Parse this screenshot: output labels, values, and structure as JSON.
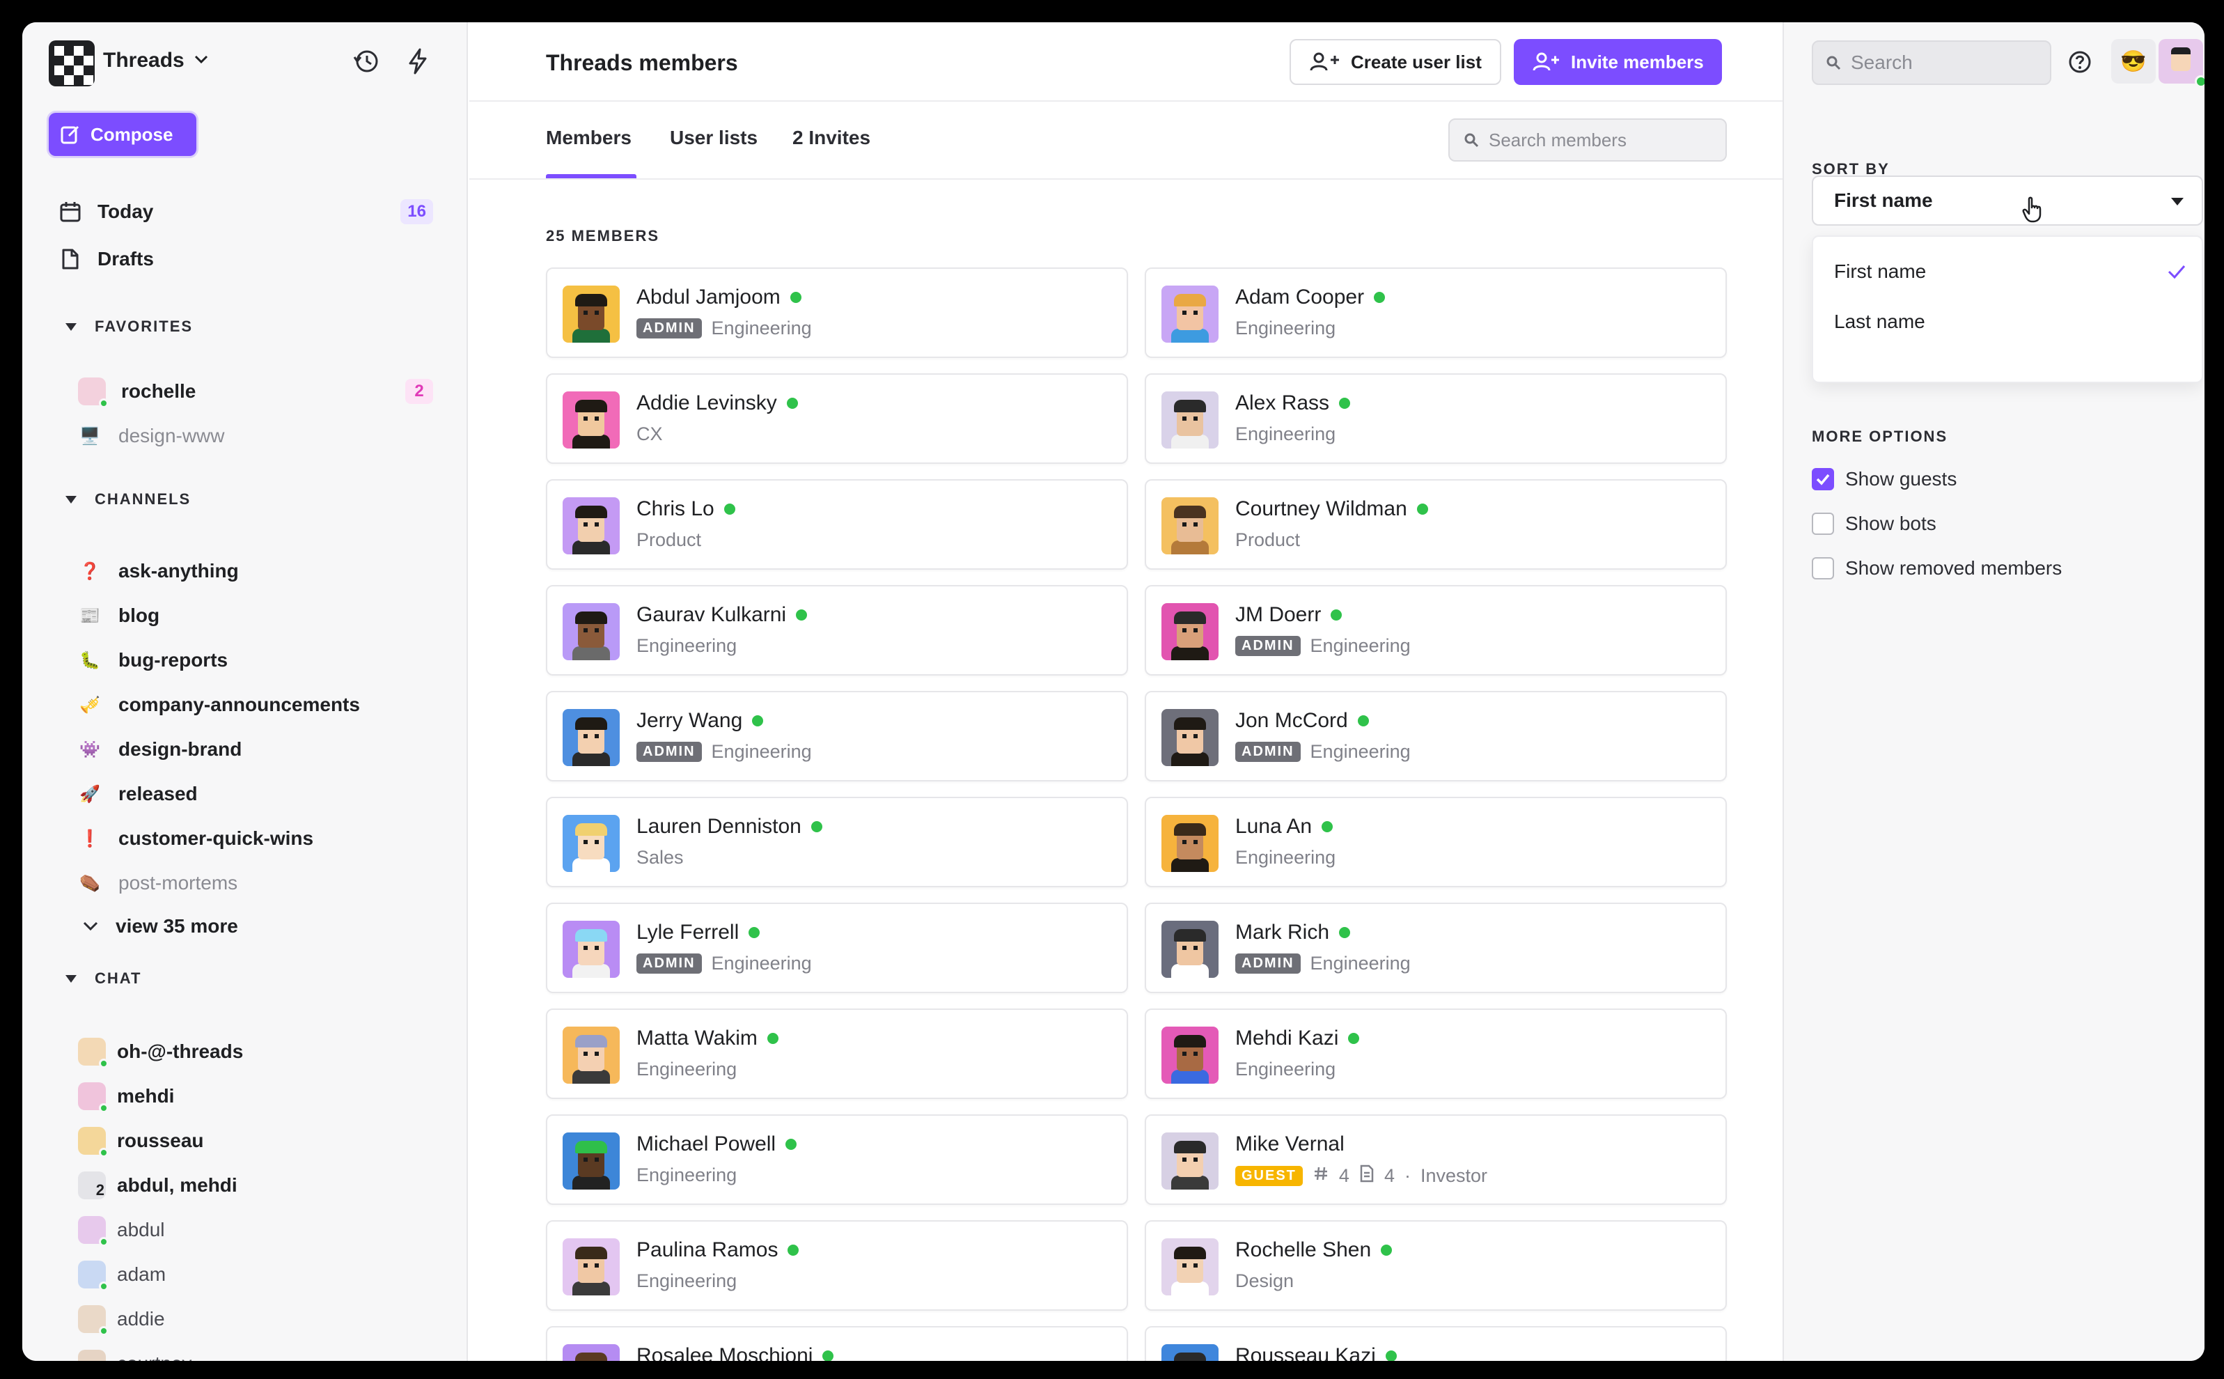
{
  "workspace": {
    "name": "Threads"
  },
  "sidebar": {
    "compose_label": "Compose",
    "nav": [
      {
        "label": "Today",
        "icon": "calendar-icon",
        "count": "16"
      },
      {
        "label": "Drafts",
        "icon": "document-icon"
      }
    ],
    "favorites_heading": "FAVORITES",
    "favorites": [
      {
        "label": "rochelle",
        "count": "2"
      },
      {
        "label": "design-www",
        "emoji": "🖥️"
      }
    ],
    "channels_heading": "CHANNELS",
    "channels": [
      {
        "label": "ask-anything",
        "emoji": "❓"
      },
      {
        "label": "blog",
        "emoji": "📰"
      },
      {
        "label": "bug-reports",
        "emoji": "🐛"
      },
      {
        "label": "company-announcements",
        "emoji": "🎺"
      },
      {
        "label": "design-brand",
        "emoji": "👾"
      },
      {
        "label": "released",
        "emoji": "🚀"
      },
      {
        "label": "customer-quick-wins",
        "emoji": "❗"
      },
      {
        "label": "post-mortems",
        "emoji": "⚰️"
      }
    ],
    "view_more": "view 35 more",
    "chat_heading": "CHAT",
    "chats": [
      {
        "label": "oh-@-threads"
      },
      {
        "label": "mehdi"
      },
      {
        "label": "rousseau"
      },
      {
        "label": "abdul, mehdi",
        "badge": "2"
      },
      {
        "label": "abdul"
      },
      {
        "label": "adam"
      },
      {
        "label": "addie"
      },
      {
        "label": "courtney"
      }
    ]
  },
  "header": {
    "title": "Threads members",
    "create_list_label": "Create user list",
    "invite_label": "Invite members"
  },
  "tabs": [
    {
      "label": "Members"
    },
    {
      "label": "User lists"
    },
    {
      "label": "2 Invites"
    }
  ],
  "member_search_placeholder": "Search members",
  "members_count": "25 MEMBERS",
  "members": [
    {
      "name": "Abdul Jamjoom",
      "team": "Engineering",
      "badge": "ADMIN",
      "online": true
    },
    {
      "name": "Adam Cooper",
      "team": "Engineering",
      "online": true
    },
    {
      "name": "Addie Levinsky",
      "team": "CX",
      "online": true
    },
    {
      "name": "Alex Rass",
      "team": "Engineering",
      "online": true
    },
    {
      "name": "Chris Lo",
      "team": "Product",
      "online": true
    },
    {
      "name": "Courtney Wildman",
      "team": "Product",
      "online": true
    },
    {
      "name": "Gaurav Kulkarni",
      "team": "Engineering",
      "online": true
    },
    {
      "name": "JM Doerr",
      "team": "Engineering",
      "badge": "ADMIN",
      "online": true
    },
    {
      "name": "Jerry Wang",
      "team": "Engineering",
      "badge": "ADMIN",
      "online": true
    },
    {
      "name": "Jon McCord",
      "team": "Engineering",
      "badge": "ADMIN",
      "online": true
    },
    {
      "name": "Lauren Denniston",
      "team": "Sales",
      "online": true
    },
    {
      "name": "Luna An",
      "team": "Engineering",
      "online": true
    },
    {
      "name": "Lyle Ferrell",
      "team": "Engineering",
      "badge": "ADMIN",
      "online": true
    },
    {
      "name": "Mark Rich",
      "team": "Engineering",
      "badge": "ADMIN",
      "online": true
    },
    {
      "name": "Matta Wakim",
      "team": "Engineering",
      "online": true
    },
    {
      "name": "Mehdi Kazi",
      "team": "Engineering",
      "online": true
    },
    {
      "name": "Michael Powell",
      "team": "Engineering",
      "online": true
    },
    {
      "name": "Mike Vernal",
      "badge": "GUEST",
      "guest_channels": "4",
      "guest_docs": "4",
      "separator": "·",
      "team": "Investor",
      "online": false
    },
    {
      "name": "Paulina Ramos",
      "team": "Engineering",
      "online": true
    },
    {
      "name": "Rochelle Shen",
      "team": "Design",
      "online": true
    },
    {
      "name": "Rosalee Moschioni",
      "team": "",
      "online": true
    },
    {
      "name": "Rousseau Kazi",
      "team": "",
      "online": true
    }
  ],
  "right_panel": {
    "search_placeholder": "Search",
    "sort_by_label": "SORT BY",
    "sort_selected": "First name",
    "sort_options": [
      "First name",
      "Last name"
    ],
    "more_options_label": "MORE OPTIONS",
    "options": [
      {
        "label": "Show guests",
        "checked": true
      },
      {
        "label": "Show bots",
        "checked": false
      },
      {
        "label": "Show removed members",
        "checked": false
      }
    ]
  },
  "colors": {
    "accent": "#7c4dff",
    "online": "#2fc24a",
    "guest": "#f7b500",
    "admin": "#6e6f76"
  }
}
